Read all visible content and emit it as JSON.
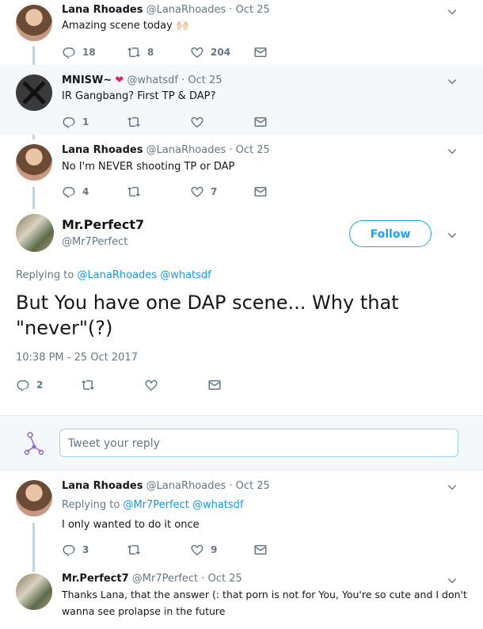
{
  "tweets": {
    "t1": {
      "name": "Lana Rhoades",
      "handle": "@LanaRhoades",
      "date": "· Oct 25",
      "text": "Amazing scene today 🙌🏻",
      "replies": "18",
      "retweets": "8",
      "likes": "204"
    },
    "t2": {
      "name": "MNISW~",
      "heart": "❤",
      "handle": "@whatsdf",
      "date": "· Oct 25",
      "text": "IR Gangbang? First TP & DAP?",
      "replies": "1",
      "retweets": "",
      "likes": ""
    },
    "t3": {
      "name": "Lana Rhoades",
      "handle": "@LanaRhoades",
      "date": "· Oct 25",
      "text": "No I'm NEVER shooting TP or DAP",
      "replies": "4",
      "retweets": "",
      "likes": "7"
    }
  },
  "focus": {
    "name": "Mr.Perfect7",
    "handle": "@Mr7Perfect",
    "follow_label": "Follow",
    "replying_prefix": "Replying to",
    "replying_to_1": "@LanaRhoades",
    "replying_to_2": "@whatsdf",
    "text_line1": "But You have one DAP scene... Why that",
    "text_line2": "\"never\"(?)",
    "timestamp": "10:38 PM - 25 Oct 2017",
    "replies": "2"
  },
  "reply_box": {
    "placeholder": "Tweet your reply"
  },
  "replies": {
    "r1": {
      "name": "Lana Rhoades",
      "handle": "@LanaRhoades",
      "date": "· Oct 25",
      "replying_prefix": "Replying to",
      "to1": "@Mr7Perfect",
      "to2": "@whatsdf",
      "text": "I only wanted to do it once",
      "replies": "3",
      "likes": "9"
    },
    "r2": {
      "name": "Mr.Perfect7",
      "handle": "@Mr7Perfect",
      "date": "· Oct 25",
      "text_line1": "Thanks Lana, that the answer (: that porn is not for You, You're so cute and I don't",
      "text_line2": "wanna see prolapse in the future"
    }
  },
  "colors": {
    "accent": "#1da1f2",
    "muted": "#657786",
    "thread": "#b8d7ee",
    "highlight_bg": "#f5f8fa"
  }
}
